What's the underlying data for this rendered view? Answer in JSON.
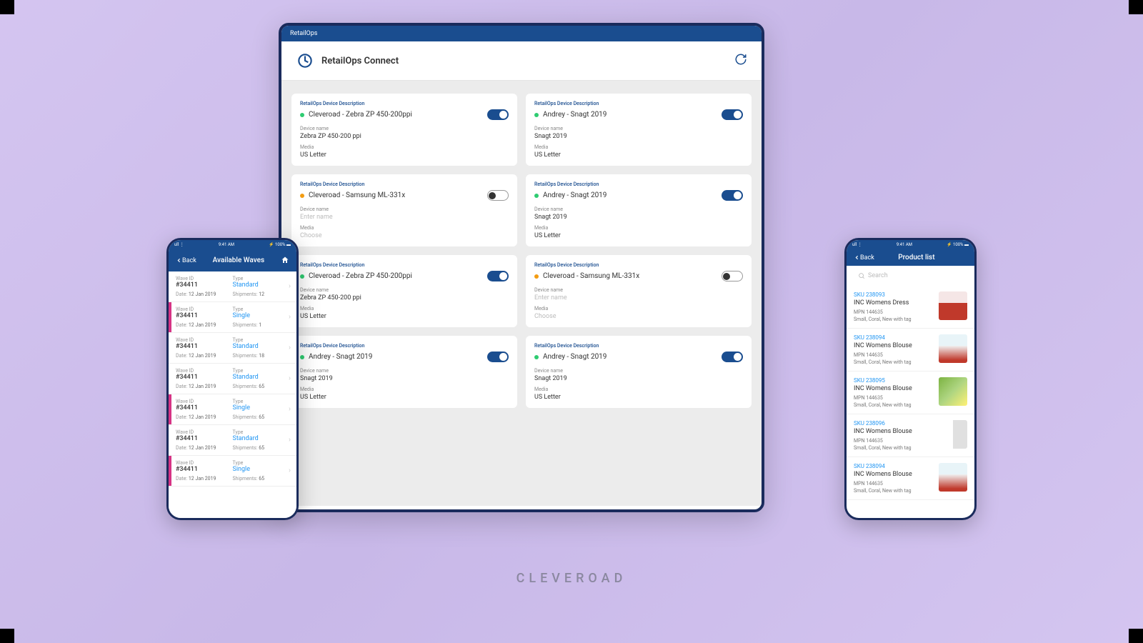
{
  "brand": "CLEVEROAD",
  "tablet": {
    "window_title": "RetailOps",
    "app_name": "RetailOps Connect",
    "labels": {
      "desc": "RetailOps Device Description",
      "name": "Device name",
      "media": "Media",
      "name_placeholder": "Enter name",
      "media_placeholder": "Choose"
    },
    "cards": [
      {
        "dot": "green",
        "title": "Cleveroad - Zebra ZP 450-200ppi",
        "on": true,
        "name": "Zebra ZP 450-200 ppi",
        "media": "US Letter"
      },
      {
        "dot": "green",
        "title": "Andrey - Snagt 2019",
        "on": true,
        "name": "Snagt 2019",
        "media": "US Letter"
      },
      {
        "dot": "yellow",
        "title": "Cleveroad - Samsung ML-331x",
        "on": false,
        "name": "",
        "media": ""
      },
      {
        "dot": "green",
        "title": "Andrey - Snagt 2019",
        "on": true,
        "name": "Snagt 2019",
        "media": "US Letter"
      },
      {
        "dot": "green",
        "title": "Cleveroad - Zebra ZP 450-200ppi",
        "on": true,
        "name": "Zebra ZP 450-200 ppi",
        "media": "US Letter"
      },
      {
        "dot": "yellow",
        "title": "Cleveroad - Samsung ML-331x",
        "on": false,
        "name": "",
        "media": ""
      },
      {
        "dot": "green",
        "title": "Andrey - Snagt 2019",
        "on": true,
        "name": "Snagt 2019",
        "media": "US Letter"
      },
      {
        "dot": "green",
        "title": "Andrey - Snagt 2019",
        "on": true,
        "name": "Snagt 2019",
        "media": "US Letter"
      }
    ]
  },
  "phone_left": {
    "status": {
      "signal": "ull ⋮",
      "time": "9:41 AM",
      "battery": "⚡ 100% ▬"
    },
    "back": "Back",
    "title": "Available Waves",
    "labels": {
      "wave_id": "Wave ID",
      "type": "Type",
      "date": "Date:",
      "shipments": "Shipments:"
    },
    "waves": [
      {
        "id": "#34411",
        "type": "Standard",
        "bar": "",
        "date": "12 Jan 2019",
        "ship": "12"
      },
      {
        "id": "#34411",
        "type": "Single",
        "bar": "magenta",
        "date": "12 Jan 2019",
        "ship": "1"
      },
      {
        "id": "#34411",
        "type": "Standard",
        "bar": "",
        "date": "12 Jan 2019",
        "ship": "18"
      },
      {
        "id": "#34411",
        "type": "Standard",
        "bar": "",
        "date": "12 Jan 2019",
        "ship": "65"
      },
      {
        "id": "#34411",
        "type": "Single",
        "bar": "magenta",
        "date": "12 Jan 2019",
        "ship": "65"
      },
      {
        "id": "#34411",
        "type": "Standard",
        "bar": "",
        "date": "12 Jan 2019",
        "ship": "65"
      },
      {
        "id": "#34411",
        "type": "Single",
        "bar": "magenta",
        "date": "12 Jan 2019",
        "ship": "65"
      }
    ]
  },
  "phone_right": {
    "status": {
      "signal": "ull ⋮",
      "time": "9:41 AM",
      "battery": "⚡ 100% ▬"
    },
    "back": "Back",
    "title": "Product list",
    "search_placeholder": "Search",
    "products": [
      {
        "sku": "SKU 238093",
        "name": "INC Womens Dress",
        "mpn": "MPN 144635",
        "meta": "Small, Coral, New with tag",
        "img": "p-red"
      },
      {
        "sku": "SKU 238094",
        "name": "INC Womens Blouse",
        "mpn": "MPN 144635",
        "meta": "Small, Coral, New with tag",
        "img": "p-white"
      },
      {
        "sku": "SKU 238095",
        "name": "INC Womens Blouse",
        "mpn": "MPN 144635",
        "meta": "Small, Coral, New with tag",
        "img": "p-green"
      },
      {
        "sku": "SKU 238096",
        "name": "INC Womens Blouse",
        "mpn": "MPN 144635",
        "meta": "Small, Coral, New with tag",
        "img": "p-side"
      },
      {
        "sku": "SKU 238094",
        "name": "INC Womens Blouse",
        "mpn": "MPN 144635",
        "meta": "Small, Coral, New with tag",
        "img": "p-white"
      }
    ]
  }
}
